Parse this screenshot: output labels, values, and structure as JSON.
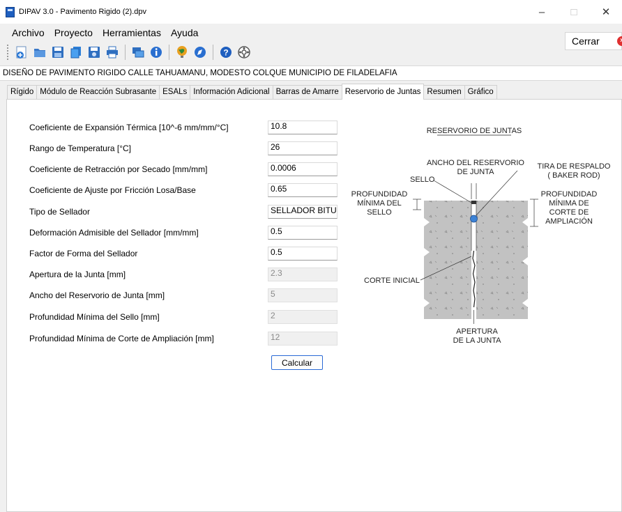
{
  "window": {
    "title": "DIPAV 3.0 - Pavimento Rigido (2).dpv",
    "minimize": "–",
    "maximize": "□",
    "close": "✕"
  },
  "menu": [
    "Archivo",
    "Proyecto",
    "Herramientas",
    "Ayuda"
  ],
  "cerrar_label": "Cerrar",
  "toolbar_icons": [
    "new-icon",
    "open-icon",
    "save-icon",
    "copy-icon",
    "save-as-icon",
    "print-icon",
    "export-icon",
    "info-icon",
    "globe-icon",
    "compass-icon",
    "help-icon",
    "settings-icon"
  ],
  "project_title": "DISEÑO DE PAVIMENTO RIGIDO CALLE TAHUAMANU, MODESTO COLQUE MUNICIPIO DE FILADELAFIA",
  "tabs": [
    {
      "label": "Rígido"
    },
    {
      "label": "Módulo de Reacción Subrasante"
    },
    {
      "label": "ESALs"
    },
    {
      "label": "Información Adicional"
    },
    {
      "label": "Barras de Amarre"
    },
    {
      "label": "Reservorio de Juntas",
      "active": true
    },
    {
      "label": "Resumen"
    },
    {
      "label": "Gráfico"
    }
  ],
  "fields": [
    {
      "label": "Coeficiente de Expansión Térmica [10^-6 mm/mm/°C]",
      "value": "10.8"
    },
    {
      "label": "Rango de Temperatura [°C]",
      "value": "26"
    },
    {
      "label": "Coeficiente de Retracción por Secado [mm/mm]",
      "value": "0.0006"
    },
    {
      "label": "Coeficiente de Ajuste por Fricción Losa/Base",
      "value": "0.65"
    },
    {
      "label": "Tipo de Sellador",
      "value": "SELLADOR BITU"
    },
    {
      "label": "Deformación Admisible del Sellador [mm/mm]",
      "value": "0.5"
    },
    {
      "label": "Factor de Forma del Sellador",
      "value": "0.5"
    },
    {
      "label": "Apertura de la Junta [mm]",
      "value": "2.3"
    },
    {
      "label": "Ancho del Reservorio de Junta [mm]",
      "value": "5"
    },
    {
      "label": "Profundidad Mínima del Sello [mm]",
      "value": "2"
    },
    {
      "label": "Profundidad Mínima de Corte de Ampliación [mm]",
      "value": "12"
    }
  ],
  "calcular_label": "Calcular",
  "diagram": {
    "title": "RESERVORIO DE JUNTAS",
    "ancho_1": "ANCHO DEL RESERVORIO",
    "ancho_2": "DE JUNTA",
    "sello": "SELLO",
    "tira_1": "TIRA DE RESPALDO",
    "tira_2": "( BAKER ROD)",
    "prof_sello_1": "PROFUNDIDAD",
    "prof_sello_2": "MÍNIMA DEL",
    "prof_sello_3": "SELLO",
    "prof_corte_1": "PROFUNDIDAD",
    "prof_corte_2": "MÍNIMA DE",
    "prof_corte_3": "CORTE DE",
    "prof_corte_4": "AMPLIACIÓN",
    "corte_inicial": "CORTE INICIAL",
    "apertura_1": "APERTURA",
    "apertura_2": "DE LA JUNTA"
  }
}
